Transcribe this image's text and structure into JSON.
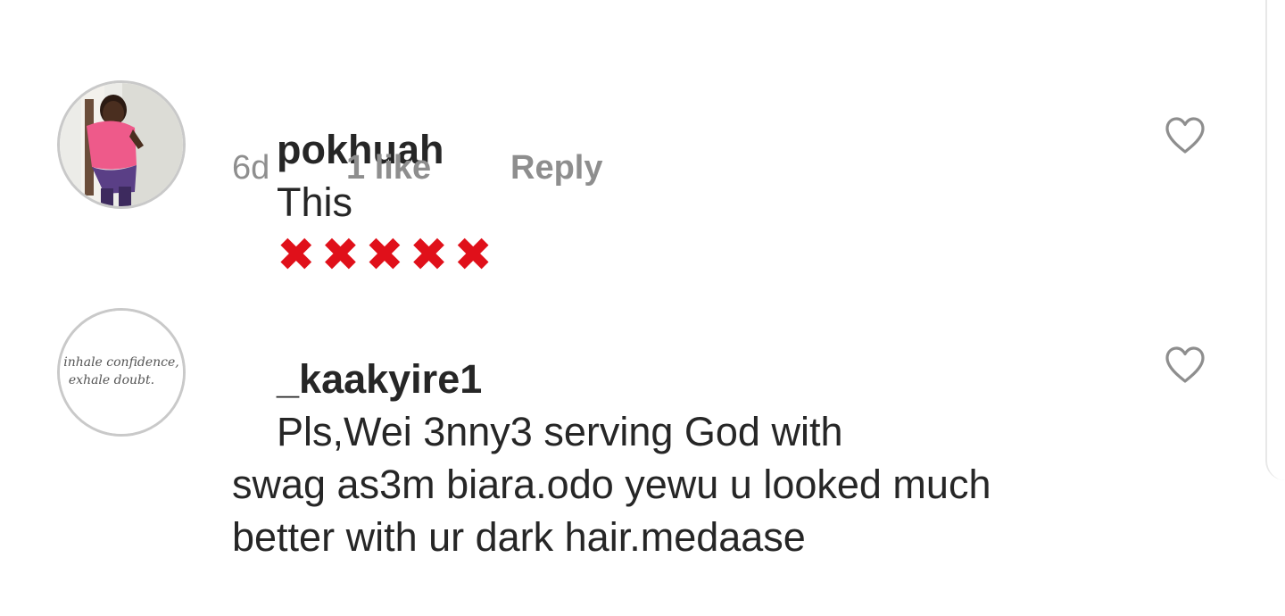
{
  "comments": [
    {
      "username": "pokhuah",
      "text": "This",
      "emoji": [
        "✖",
        "✖",
        "✖",
        "✖",
        "✖"
      ],
      "time": "6d",
      "likes": "1 like",
      "reply": "Reply",
      "avatar_icon": "profile-photo-person-pink-shirt",
      "like_icon": "heart-outline-icon"
    },
    {
      "username": "_kaakyire1",
      "text": "Pls,Wei 3nny3 serving God with\nswag as3m biara.odo yewu u looked much\nbetter with ur dark hair.medaase",
      "avatar_line1": "inhale confidence,",
      "avatar_line2": "exhale doubt.",
      "avatar_icon": "profile-photo-handwritten-quote",
      "like_icon": "heart-outline-icon"
    }
  ],
  "colors": {
    "text": "#262626",
    "meta": "#8e8e8e",
    "emoji_cross": "#e0101a",
    "avatar_border": "#c9c9c9"
  }
}
